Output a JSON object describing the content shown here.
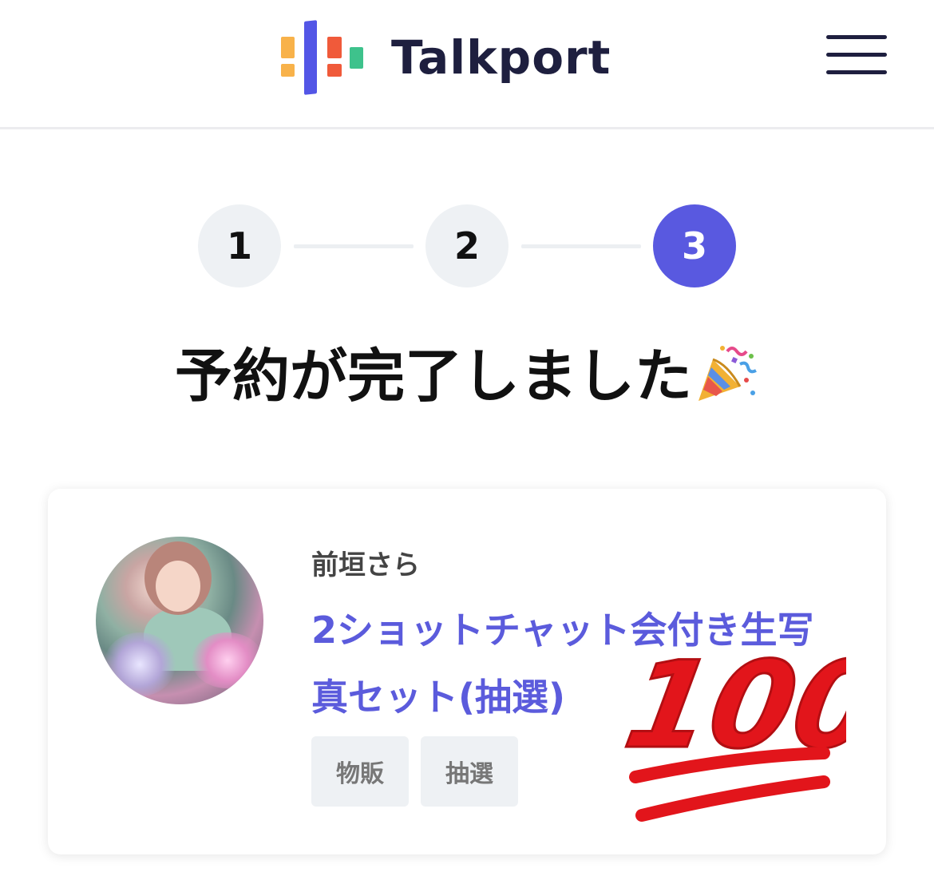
{
  "header": {
    "brand_name": "Talkport",
    "brand_colors": [
      "#f8b24a",
      "#5356e6",
      "#f05a3a",
      "#3ec28c"
    ],
    "menu_icon": "hamburger-menu-icon"
  },
  "stepper": {
    "steps": [
      "1",
      "2",
      "3"
    ],
    "active_step": 3,
    "active_color": "#5959e0"
  },
  "title": {
    "text": "予約が完了しました",
    "emoji": "party-popper-icon"
  },
  "card": {
    "artist": "前垣さら",
    "product_title": "2ショットチャット会付き生写真セット(抽選)",
    "tags": [
      "物販",
      "抽選"
    ],
    "avatar": "artist-avatar-photo",
    "title_color": "#5b5bdc"
  },
  "overlay": {
    "sticker": "hundred-points-icon",
    "sticker_text": "100"
  }
}
